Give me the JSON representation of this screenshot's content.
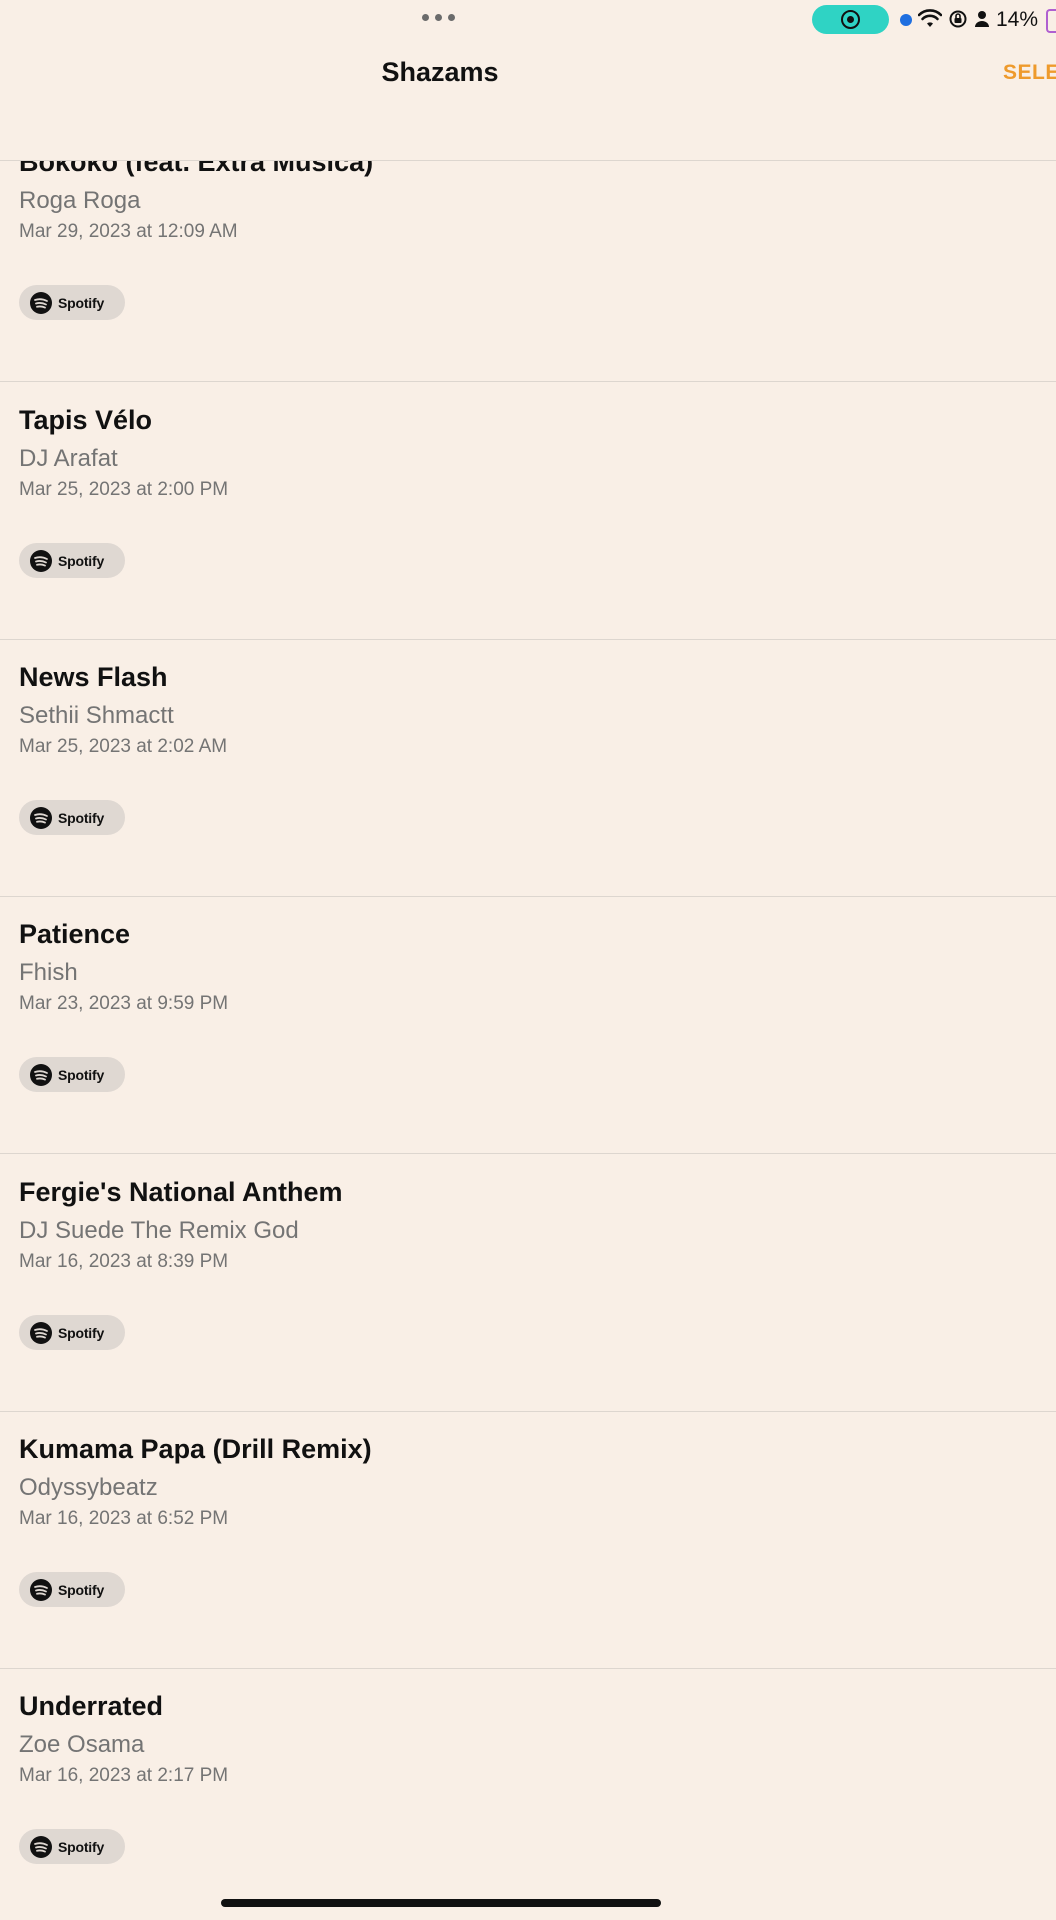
{
  "status_bar": {
    "battery_percent": "14%",
    "icons": [
      "more-dots-icon",
      "screen-record-icon",
      "dot-icon",
      "wifi-icon",
      "rotation-lock-icon",
      "person-icon",
      "battery-icon"
    ]
  },
  "nav": {
    "title": "Shazams",
    "select_label": "SELE"
  },
  "spotify_label": "Spotify",
  "songs": [
    {
      "title": "Bokoko (feat. Extra Musica)",
      "artist": "Roga Roga",
      "date": "Mar 29, 2023 at 12:09 AM"
    },
    {
      "title": "Tapis Vélo",
      "artist": "DJ Arafat",
      "date": "Mar 25, 2023 at 2:00 PM"
    },
    {
      "title": "News Flash",
      "artist": "Sethii Shmactt",
      "date": "Mar 25, 2023 at 2:02 AM"
    },
    {
      "title": "Patience",
      "artist": "Fhish",
      "date": "Mar 23, 2023 at 9:59 PM"
    },
    {
      "title": "Fergie's National Anthem",
      "artist": "DJ Suede The Remix God",
      "date": "Mar 16, 2023 at 8:39 PM"
    },
    {
      "title": "Kumama Papa (Drill Remix)",
      "artist": "Odyssybeatz",
      "date": "Mar 16, 2023 at 6:52 PM"
    },
    {
      "title": "Underrated",
      "artist": "Zoe Osama",
      "date": "Mar 16, 2023 at 2:17 PM"
    }
  ],
  "colors": {
    "background": "#f9efe6",
    "accent": "#ee9a2c",
    "secondary_text": "#747474",
    "record_pill": "#2fd3c4"
  }
}
